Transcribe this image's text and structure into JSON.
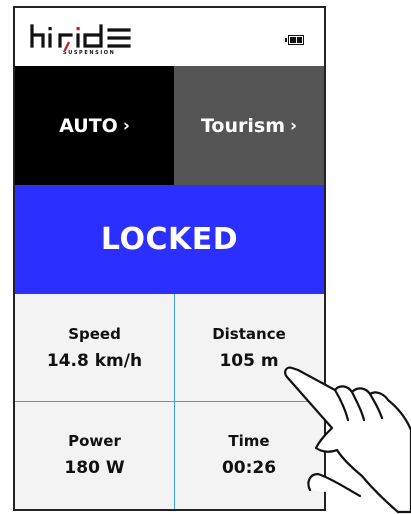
{
  "brand": {
    "logo_text": "hiride",
    "logo_subtext": "SUSPENSION"
  },
  "status": {
    "battery_icon": "battery-icon",
    "battery_level": "partial"
  },
  "modes": {
    "left": {
      "label": "AUTO",
      "chevron": "›"
    },
    "right": {
      "label": "Tourism",
      "chevron": "›"
    }
  },
  "lock_state": {
    "label": "LOCKED"
  },
  "metrics": [
    {
      "label": "Speed",
      "value": "14.8 km/h"
    },
    {
      "label": "Distance",
      "value": "105 m"
    },
    {
      "label": "Power",
      "value": "180 W"
    },
    {
      "label": "Time",
      "value": "00:26"
    }
  ],
  "colors": {
    "auto_bg": "#000000",
    "tourism_bg": "#555555",
    "locked_bg": "#2b2fff",
    "grid_line": "#3aa0e8",
    "logo_accent": "#d01c1c"
  },
  "overlay": {
    "icon": "pointing-hand-icon"
  }
}
